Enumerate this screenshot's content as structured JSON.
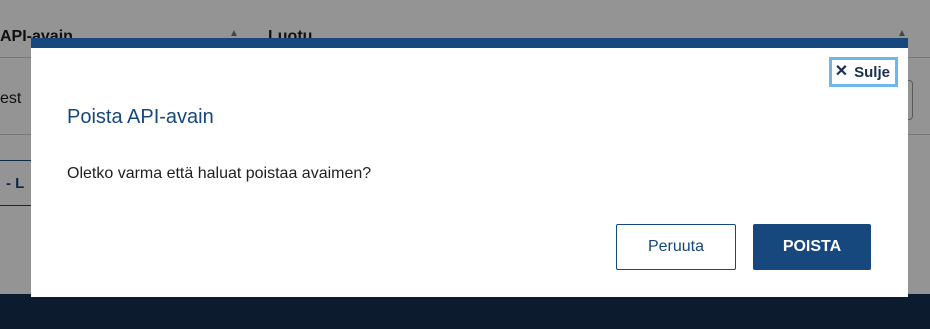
{
  "background": {
    "table_columns": [
      "API-avain",
      "Luotu"
    ],
    "row_partial_text": "est",
    "button_partial_label": "- L"
  },
  "modal": {
    "close_label": "Sulje",
    "close_icon": "close-icon",
    "title": "Poista API-avain",
    "message": "Oletko varma että haluat poistaa avaimen?",
    "cancel_label": "Peruuta",
    "delete_label": "POISTA"
  },
  "colors": {
    "primary": "#16477d",
    "footer": "#16304f",
    "focus_outline": "#6fb6e8"
  }
}
